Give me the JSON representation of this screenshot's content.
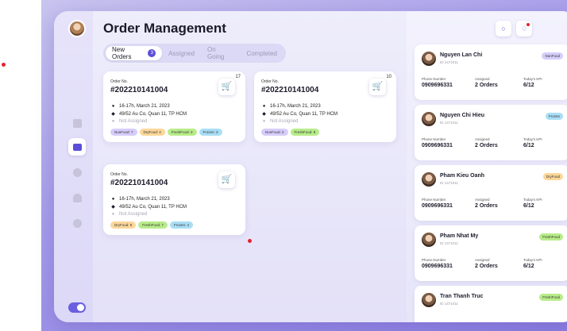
{
  "colors": {
    "accent": "#5b4fd8",
    "tag_nonfood": "#d6cdfb",
    "tag_dryfood": "#fbd79a",
    "tag_freshfood": "#b8ec8a",
    "tag_frozen": "#a9def5"
  },
  "main": {
    "title": "Order Management",
    "tabs": [
      {
        "label": "New Orders",
        "count": "3"
      },
      {
        "label": "Assigned"
      },
      {
        "label": "On Going"
      },
      {
        "label": "Completed"
      }
    ]
  },
  "orders": [
    {
      "label": "Order No.",
      "number": "#202210141004",
      "cart_icon": "cart-icon",
      "cart_count": "17",
      "time": "16-17h, March 21, 2023",
      "address": "49/52 Au Co, Quan 11, TP HCM",
      "status": "Not Assigned",
      "tags": [
        {
          "label": "NonFood: 7",
          "type": "nonfood"
        },
        {
          "label": "DryFood: 4",
          "type": "dryfood"
        },
        {
          "label": "FreshFood: 3",
          "type": "freshfood"
        },
        {
          "label": "Frozen: 3",
          "type": "frozen"
        }
      ]
    },
    {
      "label": "Order No.",
      "number": "#202210141004",
      "cart_icon": "cart-icon",
      "cart_count": "10",
      "time": "16-17h, March 21, 2023",
      "address": "49/52 Au Co, Quan 11, TP HCM",
      "status": "Not Assigned",
      "tags": [
        {
          "label": "NonFood: 2",
          "type": "nonfood"
        },
        {
          "label": "FreshFood: 8",
          "type": "freshfood"
        }
      ]
    },
    {
      "label": "Order No.",
      "number": "#202210141004",
      "cart_icon": "cart-icon",
      "cart_count": "",
      "time": "16-17h, March 21, 2023",
      "address": "49/52 Au Co, Quan 11, TP HCM",
      "status": "Not Assigned",
      "tags": [
        {
          "label": "DryFood: 9",
          "type": "dryfood"
        },
        {
          "label": "FreshFood: 7",
          "type": "freshfood"
        },
        {
          "label": "Frozen: 4",
          "type": "frozen"
        }
      ]
    }
  ],
  "staff": [
    {
      "name": "Nguyen Lan Chi",
      "id": "ID 1471011",
      "tag": "NonFood",
      "tag_type": "nonfood",
      "phone_label": "Phone Number",
      "phone": "0909696331",
      "assigned_label": "Assigned",
      "assigned": "2 Orders",
      "kpi_label": "Today's KPI",
      "kpi": "6/12"
    },
    {
      "name": "Nguyen Chi Hieu",
      "id": "ID 1471011",
      "tag": "Frozen",
      "tag_type": "frozen",
      "phone_label": "Phone Number",
      "phone": "0909696331",
      "assigned_label": "Assigned",
      "assigned": "2 Orders",
      "kpi_label": "Today's KPI",
      "kpi": "6/12"
    },
    {
      "name": "Pham Kieu Oanh",
      "id": "ID 1471011",
      "tag": "DryFood",
      "tag_type": "dryfood",
      "phone_label": "Phone Number",
      "phone": "0909696331",
      "assigned_label": "Assigned",
      "assigned": "2 Orders",
      "kpi_label": "Today's KPI",
      "kpi": "6/12"
    },
    {
      "name": "Pham Nhat My",
      "id": "ID 1471011",
      "tag": "FreshFood",
      "tag_type": "freshfood",
      "phone_label": "Phone Number",
      "phone": "0909696331",
      "assigned_label": "Assigned",
      "assigned": "2 Orders",
      "kpi_label": "Today's KPI",
      "kpi": "6/12"
    },
    {
      "name": "Tran Thanh Truc",
      "id": "ID 1471011",
      "tag": "FreshFood",
      "tag_type": "freshfood"
    }
  ],
  "icons": {
    "search": "search-icon",
    "notification": "bell-icon",
    "time": "clock-icon",
    "address": "location-pin-icon",
    "status": "user-icon",
    "rail": [
      "calendar-icon",
      "orders-icon",
      "users-icon",
      "bell-icon",
      "gear-icon"
    ]
  },
  "sidebar": {
    "toggle_on": true
  }
}
